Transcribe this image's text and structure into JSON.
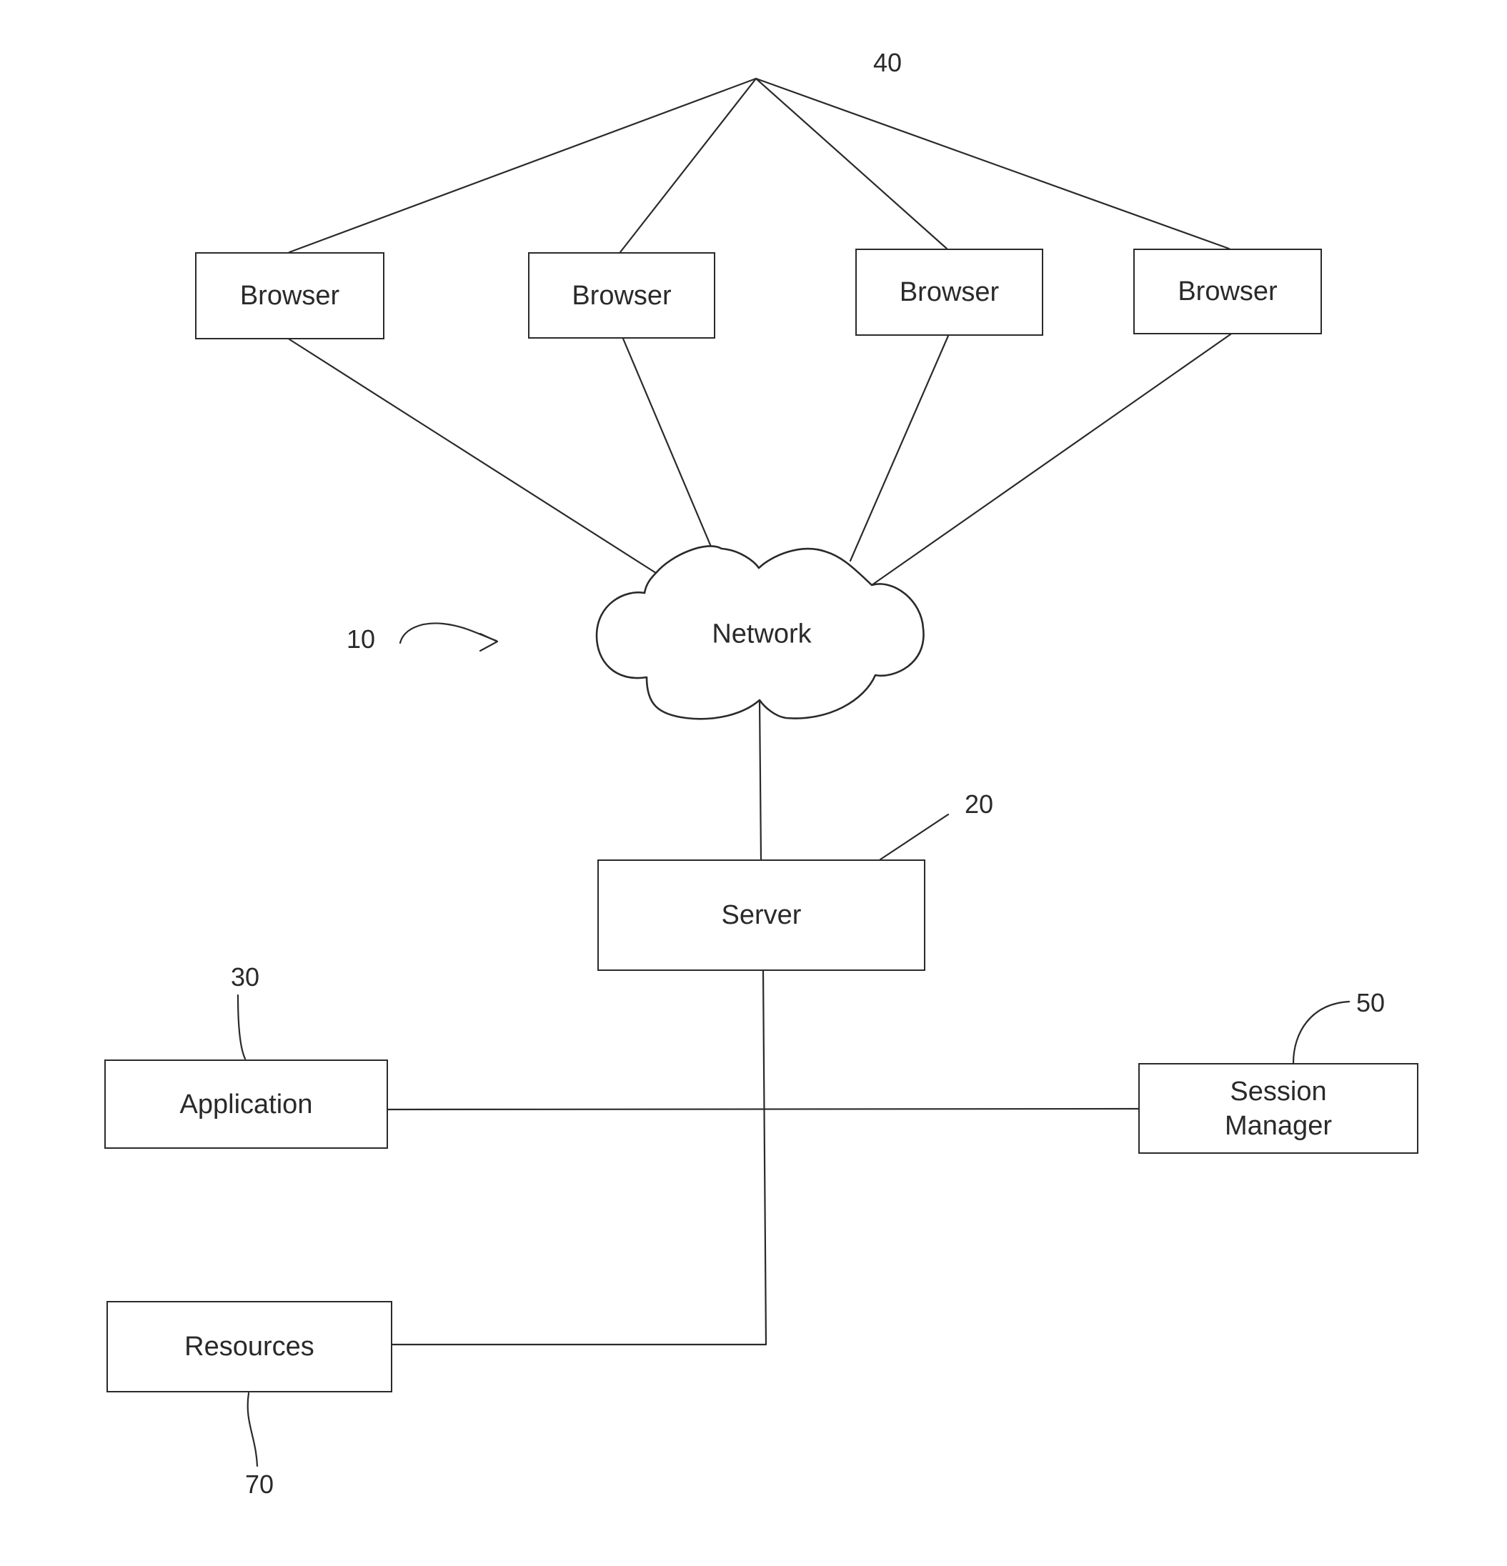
{
  "figure": {
    "system_ref": "10",
    "browsers_ref": "40",
    "server_ref": "20",
    "application_ref": "30",
    "session_manager_ref": "50",
    "resources_ref": "70"
  },
  "nodes": {
    "browsers": [
      {
        "label": "Browser"
      },
      {
        "label": "Browser"
      },
      {
        "label": "Browser"
      },
      {
        "label": "Browser"
      }
    ],
    "network": {
      "label": "Network"
    },
    "server": {
      "label": "Server"
    },
    "application": {
      "label": "Application"
    },
    "session_manager": {
      "label_line1": "Session",
      "label_line2": "Manager"
    },
    "resources": {
      "label": "Resources"
    }
  }
}
